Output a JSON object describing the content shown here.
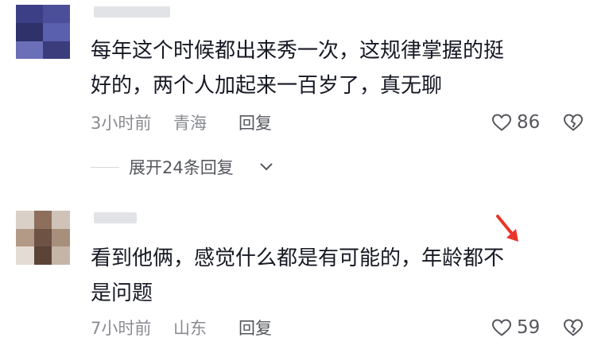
{
  "comments": [
    {
      "text_line1": "每年这个时候都出来秀一次，这规律掌握的挺",
      "text_line2": "好的，两个人加起来一百岁了，真无聊",
      "time": "3小时前",
      "location": "青海",
      "reply_label": "回复",
      "like_count": "86"
    },
    {
      "text_line1": "看到他俩，感觉什么都是有可能的，年龄都不",
      "text_line2": "是问题",
      "time": "7小时前",
      "location": "山东",
      "reply_label": "回复",
      "like_count": "59"
    }
  ],
  "expand_replies": {
    "label": "展开24条回复"
  },
  "icons": {
    "like": "heart-outline-icon",
    "dislike": "broken-heart-icon",
    "expand": "chevron-down-icon",
    "annotation": "red-arrow-icon"
  },
  "colors": {
    "text": "#161823",
    "meta": "#8a8b91",
    "secondary": "#55575d",
    "arrow": "#e8362a"
  }
}
